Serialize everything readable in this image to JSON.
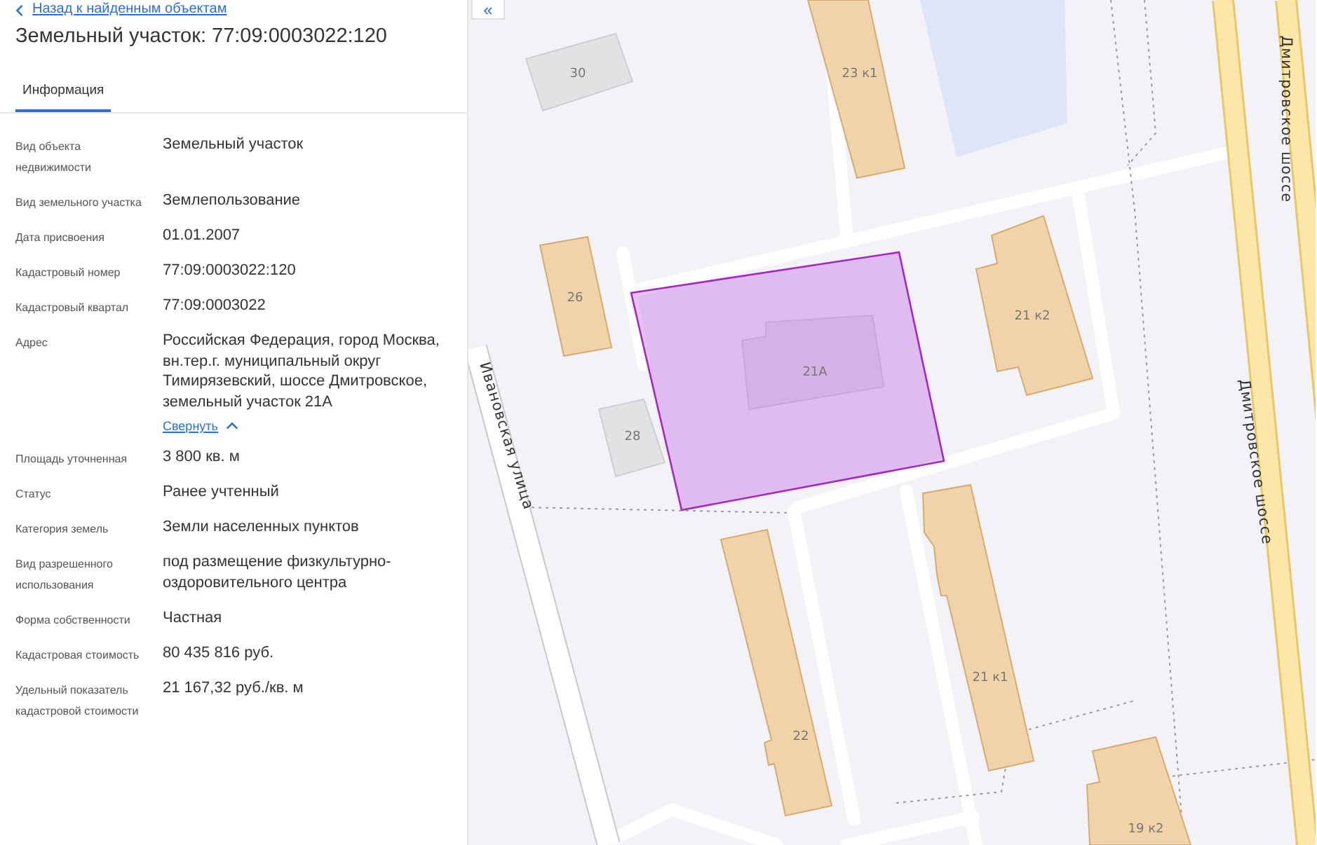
{
  "back_link": "Назад к найденным объектам",
  "title": "Земельный участок: 77:09:0003022:120",
  "tabs": [
    {
      "label": "Информация",
      "selected": true
    }
  ],
  "fields": [
    {
      "label": "Вид объекта недвижимости",
      "value": "Земельный участок"
    },
    {
      "label": "Вид земельного участка",
      "value": "Землепользование"
    },
    {
      "label": "Дата присвоения",
      "value": "01.01.2007"
    },
    {
      "label": "Кадастровый номер",
      "value": "77:09:0003022:120"
    },
    {
      "label": "Кадастровый квартал",
      "value": "77:09:0003022"
    },
    {
      "label": "Адрес",
      "value": "Российская Федерация, город Москва, вн.тер.г. муниципальный округ Тимирязевский, шоссе Дмитровское, земельный участок 21А",
      "toggle": {
        "label": "Свернуть",
        "expanded": true
      }
    },
    {
      "label": "Площадь уточненная",
      "value": "3 800 кв. м"
    },
    {
      "label": "Статус",
      "value": "Ранее учтенный"
    },
    {
      "label": "Категория земель",
      "value": "Земли населенных пунктов"
    },
    {
      "label": "Вид разрешенного использования",
      "value": "под размещение физкультурно-оздоровительного центра"
    },
    {
      "label": "Форма собственности",
      "value": "Частная"
    },
    {
      "label": "Кадастровая стоимость",
      "value": "80 435 816 руб."
    },
    {
      "label": "Удельный показатель кадастровой стоимости",
      "value": "21 167,32 руб./кв. м"
    }
  ],
  "map": {
    "collapse_button": "«",
    "buildings": [
      {
        "label": "30",
        "kind": "other"
      },
      {
        "label": "23 к1",
        "kind": "residential"
      },
      {
        "label": "26",
        "kind": "residential"
      },
      {
        "label": "21А",
        "kind": "other"
      },
      {
        "label": "21 к2",
        "kind": "residential"
      },
      {
        "label": "28",
        "kind": "other"
      },
      {
        "label": "22",
        "kind": "residential"
      },
      {
        "label": "21 к1",
        "kind": "residential"
      },
      {
        "label": "19 к2",
        "kind": "residential"
      }
    ],
    "streets": [
      {
        "label": "Ивановская улица"
      },
      {
        "label": "Дмитровское шоссе"
      },
      {
        "label": "Дмитровское шоссе"
      }
    ]
  }
}
